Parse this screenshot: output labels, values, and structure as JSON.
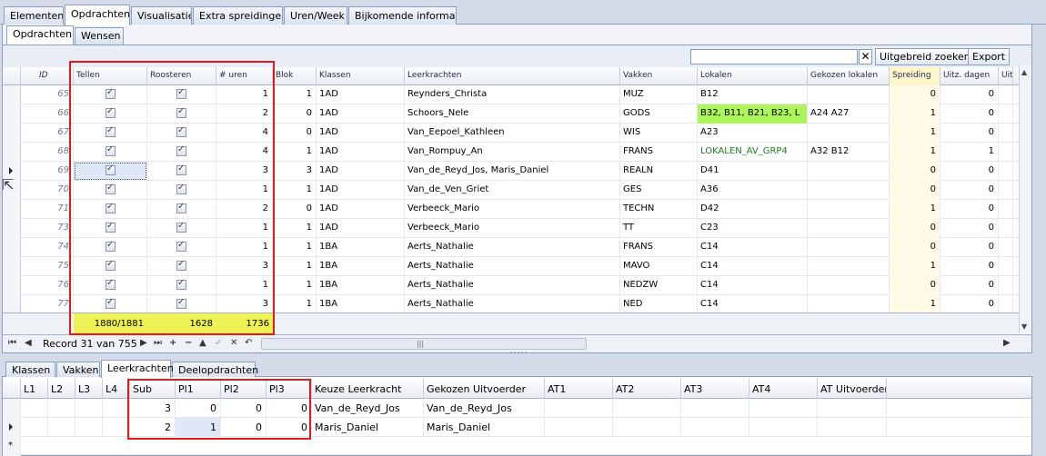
{
  "top_tabs": [
    "Elementen",
    "Opdrachten",
    "Visualisatie",
    "Extra spreidingen",
    "Uren/Week",
    "Bijkomende informatie"
  ],
  "top_active": 1,
  "sub_tabs": [
    "Opdrachten",
    "Wensen"
  ],
  "sub_active": 0,
  "toolbar": {
    "clear": "✕",
    "advanced_search": "Uitgebreid zoeken",
    "export": "Export"
  },
  "grid": {
    "headers": [
      "ID",
      "Tellen",
      "Roosteren",
      "# uren",
      "Blok",
      "Klassen",
      "Leerkrachten",
      "Vakken",
      "Lokalen",
      "Gekozen lokalen",
      "Spreiding",
      "Uitz. dagen",
      "Uit"
    ],
    "rows": [
      {
        "id": "65",
        "uren": "1",
        "blok": "1",
        "klas": "1AD",
        "lk": "Reynders_Christa",
        "vak": "MUZ",
        "lok": "B12",
        "gek": "",
        "spr": "0",
        "uitz": "0"
      },
      {
        "id": "66",
        "uren": "2",
        "blok": "0",
        "klas": "1AD",
        "lk": "Schoors_Nele",
        "vak": "GODS",
        "lok": "B32, B11, B21, B23, L",
        "gek": "A24 A27",
        "spr": "1",
        "uitz": "0"
      },
      {
        "id": "67",
        "uren": "4",
        "blok": "0",
        "klas": "1AD",
        "lk": "Van_Eepoel_Kathleen",
        "vak": "WIS",
        "lok": "A23",
        "gek": "",
        "spr": "1",
        "uitz": "0"
      },
      {
        "id": "68",
        "uren": "4",
        "blok": "1",
        "klas": "1AD",
        "lk": "Van_Rompuy_An",
        "vak": "FRANS",
        "lok": "LOKALEN_AV_GRP4",
        "gek": "A32 B12",
        "spr": "1",
        "uitz": "1"
      },
      {
        "id": "69",
        "uren": "3",
        "blok": "3",
        "klas": "1AD",
        "lk": "Van_de_Reyd_Jos,  Maris_Daniel",
        "vak": "REALN",
        "lok": "D41",
        "gek": "",
        "spr": "0",
        "uitz": "0"
      },
      {
        "id": "70",
        "uren": "1",
        "blok": "1",
        "klas": "1AD",
        "lk": "Van_de_Ven_Griet",
        "vak": "GES",
        "lok": "A36",
        "gek": "",
        "spr": "0",
        "uitz": "0"
      },
      {
        "id": "71",
        "uren": "2",
        "blok": "0",
        "klas": "1AD",
        "lk": "Verbeeck_Mario",
        "vak": "TECHN",
        "lok": "D42",
        "gek": "",
        "spr": "1",
        "uitz": "0"
      },
      {
        "id": "73",
        "uren": "1",
        "blok": "1",
        "klas": "1AD",
        "lk": "Verbeeck_Mario",
        "vak": "TT",
        "lok": "C23",
        "gek": "",
        "spr": "0",
        "uitz": "0"
      },
      {
        "id": "74",
        "uren": "1",
        "blok": "1",
        "klas": "1BA",
        "lk": "Aerts_Nathalie",
        "vak": "FRANS",
        "lok": "C14",
        "gek": "",
        "spr": "0",
        "uitz": "0"
      },
      {
        "id": "75",
        "uren": "3",
        "blok": "1",
        "klas": "1BA",
        "lk": "Aerts_Nathalie",
        "vak": "MAVO",
        "lok": "C14",
        "gek": "",
        "spr": "1",
        "uitz": "0"
      },
      {
        "id": "76",
        "uren": "1",
        "blok": "1",
        "klas": "1BA",
        "lk": "Aerts_Nathalie",
        "vak": "NEDZW",
        "lok": "C14",
        "gek": "",
        "spr": "0",
        "uitz": "0"
      },
      {
        "id": "77",
        "uren": "3",
        "blok": "1",
        "klas": "1BA",
        "lk": "Aerts_Nathalie",
        "vak": "NED",
        "lok": "C14",
        "gek": "",
        "spr": "1",
        "uitz": "0"
      }
    ],
    "totals": {
      "tellen": "1880/1881",
      "roosteren": "1628",
      "uren": "1736"
    }
  },
  "nav": {
    "record_text": "Record 31 van 755"
  },
  "bottom_tabs": [
    "Klassen",
    "Vakken",
    "Leerkrachten",
    "Deelopdrachten"
  ],
  "bottom_active": 2,
  "bottom_grid": {
    "headers": [
      "L1",
      "L2",
      "L3",
      "L4",
      "Sub",
      "Pl1",
      "Pl2",
      "Pl3",
      "Keuze Leerkracht",
      "Gekozen Uitvoerder",
      "AT1",
      "AT2",
      "AT3",
      "AT4",
      "AT Uitvoerder"
    ],
    "rows": [
      {
        "sub": "3",
        "pl1": "0",
        "pl2": "0",
        "pl3": "0",
        "keuze": "Van_de_Reyd_Jos",
        "gekozen": "Van_de_Reyd_Jos"
      },
      {
        "sub": "2",
        "pl1": "1",
        "pl2": "0",
        "pl3": "0",
        "keuze": "Maris_Daniel",
        "gekozen": "Maris_Daniel"
      }
    ],
    "new_row_marker": "*"
  },
  "colors": {
    "highlight_red": "#e01b1b",
    "footer_yellow": "#eef255",
    "lokaal_green": "#adf55a"
  }
}
